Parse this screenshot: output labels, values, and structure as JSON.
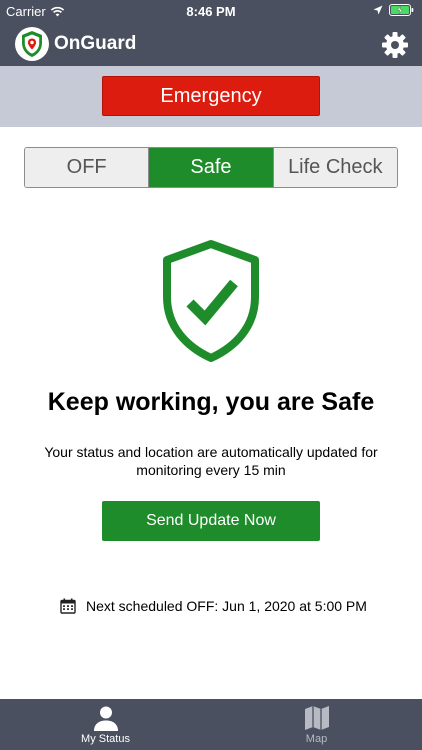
{
  "status_bar": {
    "carrier": "Carrier",
    "time": "8:46 PM",
    "icons": [
      "wifi-icon",
      "location-arrow-icon",
      "battery-charging-icon"
    ]
  },
  "header": {
    "title": "OnGuard",
    "logo_icon": "onguard-shield-logo",
    "settings_icon": "gear-icon"
  },
  "emergency": {
    "label": "Emergency",
    "color": "#dd1c10"
  },
  "mode_selector": {
    "options": [
      {
        "label": "OFF",
        "active": false
      },
      {
        "label": "Safe",
        "active": true
      },
      {
        "label": "Life Check",
        "active": false
      }
    ],
    "active_color": "#1e8c2a"
  },
  "status": {
    "icon": "shield-check-icon",
    "headline": "Keep working, you are Safe",
    "description": "Your status and location are automatically updated for monitoring every 15 min"
  },
  "send_update": {
    "label": "Send Update Now"
  },
  "schedule": {
    "icon": "calendar-icon",
    "text": "Next scheduled OFF: Jun 1, 2020 at 5:00 PM"
  },
  "tab_bar": {
    "tabs": [
      {
        "label": "My Status",
        "icon": "person-icon",
        "active": true
      },
      {
        "label": "Map",
        "icon": "map-icon",
        "active": false
      }
    ]
  }
}
